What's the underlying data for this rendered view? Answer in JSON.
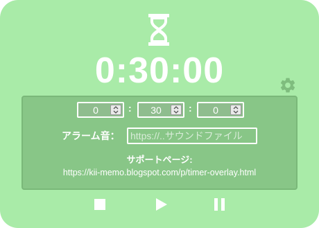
{
  "timer": {
    "display": "0:30:00"
  },
  "settings": {
    "hours": "0",
    "minutes": "30",
    "seconds": "0",
    "separator": ":"
  },
  "alarm": {
    "label": "アラーム音：",
    "placeholder": "https://..サウンドファイル"
  },
  "support": {
    "title": "サポートページ:",
    "url": "https://kii-memo.blogspot.com/p/timer-overlay.html"
  },
  "icons": {
    "timer": "hourglass-icon",
    "settings": "gear-icon",
    "stop": "stop-icon",
    "play": "play-icon",
    "pause": "pause-icon"
  },
  "colors": {
    "background": "#a9eba8",
    "panel": "#88c687",
    "foreground": "#ffffff"
  }
}
